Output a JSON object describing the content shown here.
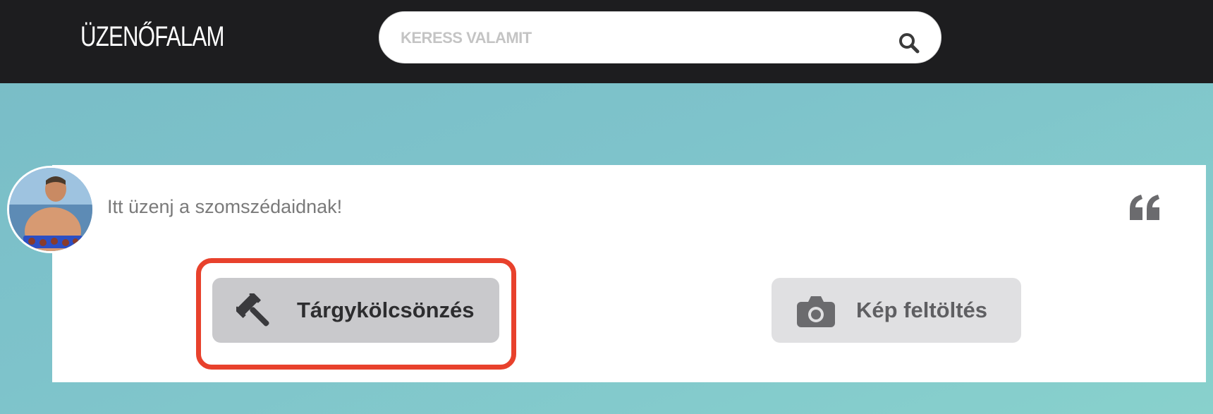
{
  "header": {
    "brand": "ÜZENŐFALAM",
    "search": {
      "placeholder": "KERESS VALAMIT",
      "value": "",
      "icon": "search-icon"
    }
  },
  "composer": {
    "prompt": "Itt üzenj a szomszédaidnak!",
    "avatar_icon": "user-avatar",
    "quote_icon": "quote-icon",
    "actions": [
      {
        "label": "Tárgykölcsönzés",
        "icon": "gavel-icon"
      },
      {
        "label": "Kép feltöltés",
        "icon": "camera-icon"
      }
    ]
  },
  "colors": {
    "topbar": "#1d1d1f",
    "highlight": "#e8412c",
    "background": "#7ec3cb"
  }
}
